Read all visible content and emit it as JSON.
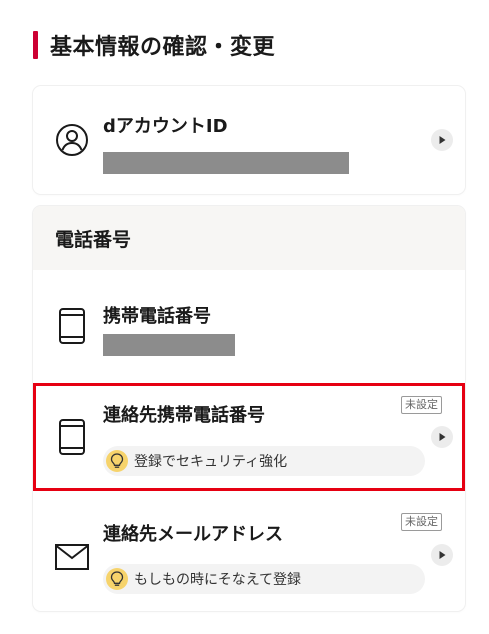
{
  "section": {
    "title": "基本情報の確認・変更"
  },
  "account": {
    "label": "dアカウントID"
  },
  "phone": {
    "header": "電話番号",
    "mobile_label": "携帯電話番号",
    "contact_mobile_label": "連絡先携帯電話番号",
    "contact_mobile_badge": "未設定",
    "contact_mobile_tip": "登録でセキュリティ強化",
    "contact_email_label": "連絡先メールアドレス",
    "contact_email_badge": "未設定",
    "contact_email_tip": "もしもの時にそなえて登録"
  },
  "colors": {
    "accent": "#cc0033",
    "highlight": "#e60012",
    "masked": "#8c8c8c",
    "bulb": "#f6d36b"
  },
  "icons": {
    "account": "user-circle-icon",
    "phone": "smartphone-icon",
    "email": "envelope-icon",
    "chevron": "play-arrow-icon",
    "tip": "lightbulb-icon"
  }
}
